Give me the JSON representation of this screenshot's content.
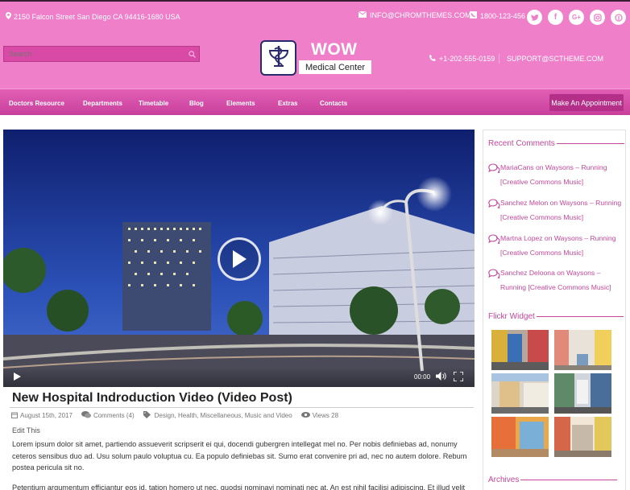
{
  "topbar": {
    "address": "2150 Falcon Street San Diego CA 94416-1680 USA",
    "email": "INFO@CHROMTHEMES.COM",
    "phone": "1800-123-456",
    "social_icons": [
      "twitter-icon",
      "facebook-icon",
      "google-plus-icon",
      "instagram-icon",
      "pinterest-icon"
    ]
  },
  "search": {
    "placeholder": "Search"
  },
  "logo": {
    "title": "WOW",
    "subtitle": "Medical Center"
  },
  "header_contact": {
    "phone": "+1-202-555-0159",
    "email": "SUPPORT@SCTHEME.COM"
  },
  "nav": {
    "items": [
      "Doctors Resource",
      "Departments",
      "Timetable",
      "Blog",
      "Elements",
      "Extras",
      "Contacts"
    ],
    "cta": "Make An Appointment"
  },
  "video": {
    "time": "00:00"
  },
  "post": {
    "title": "New Hospital Indroduction Video (Video Post)",
    "date": "August 15th, 2017",
    "comments": "Comments (4)",
    "tags": "Design,  Health,  Miscellaneous,  Music and Video",
    "views": "Views 28",
    "edit": "Edit This",
    "paragraph1": "Lorem ipsum dolor sit amet, partiendo assueverit scripserit ei qui, docendi gubergren intellegat mel no. Per nobis definiebas ad, nonumy ceteros sensibus duo ad. Usu solum paulo voluptua cu. Ea populo definiebas sit. Sumo erat convenire pri ad, nec no autem dolore. Rebum postea pericula sit no.",
    "paragraph2": "Petentium argumentum efficiantur eos id, tation homero ut nec, quodsi nominavi nominati nec at. An est nihil facilisi adipiscing. Et illud velit"
  },
  "sidebar": {
    "recent_comments_title": "Recent Comments",
    "comments": [
      "MariaCans on Waysons – Running [Creative Commons Music]",
      "Sanchez Melon on Waysons – Running [Creative Commons Music]",
      "Martna Lopez on Waysons – Running [Creative Commons Music]",
      "Sanchez Deloona on Waysons – Running [Creative Commons Music]"
    ],
    "flickr_title": "Flickr Widget",
    "archives_title": "Archives"
  },
  "colors": {
    "header": "#ef7fc9",
    "nav": "#d650ad",
    "accent": "#c4479b",
    "button": "#b42f87"
  }
}
